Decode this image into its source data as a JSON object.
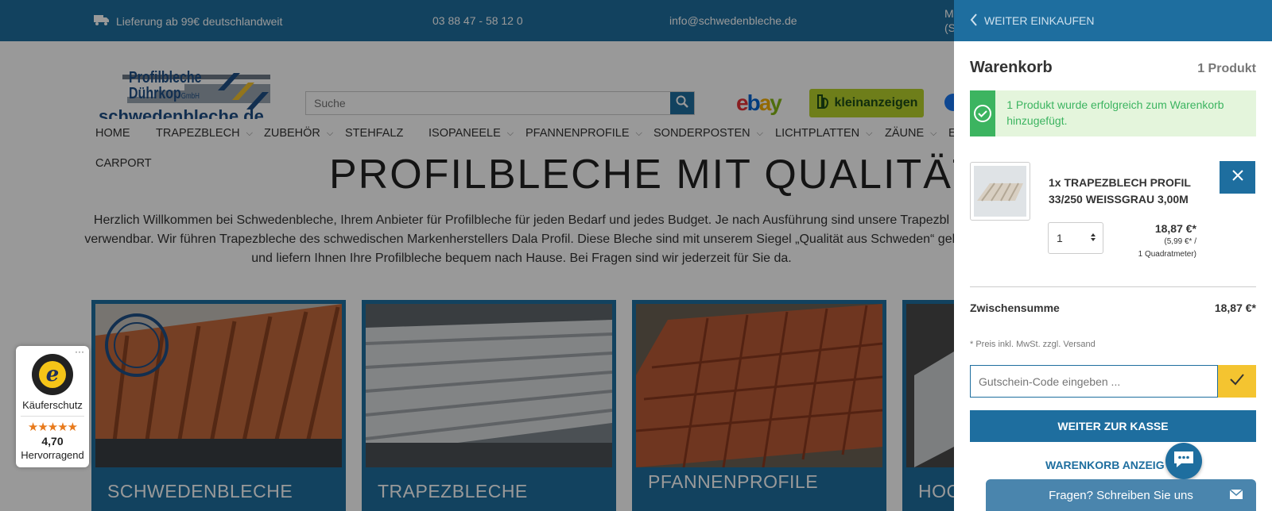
{
  "topbar": {
    "shipping": "Lieferung ab 99€ deutschlandweit",
    "phone": "03 88 47 - 58 12 0",
    "email": "info@schwedenbleche.de",
    "more_line1": "M",
    "more_line2": "(S"
  },
  "header": {
    "logo_line1": "Profilbleche",
    "logo_line2": "Dührkop",
    "logo_suffix": "GmbH",
    "logo_url": "schwedenbleche.de",
    "search_placeholder": "Suche",
    "ebay_label": "ebay",
    "kleinanzeigen_label": "kleinanzeigen"
  },
  "nav": {
    "items": [
      {
        "label": "HOME",
        "chevron": false
      },
      {
        "label": "TRAPEZBLECH",
        "chevron": true
      },
      {
        "label": "ZUBEHÖR",
        "chevron": true
      },
      {
        "label": "STEHFALZ",
        "chevron": false
      },
      {
        "label": "ISOPANEELE",
        "chevron": true
      },
      {
        "label": "PFANNENPROFILE",
        "chevron": true
      },
      {
        "label": "SONDERPOSTEN",
        "chevron": true
      },
      {
        "label": "LICHTPLATTEN",
        "chevron": true
      },
      {
        "label": "ZÄUNE",
        "chevron": true
      },
      {
        "label": "E",
        "chevron": false
      },
      {
        "label": "CARPORT",
        "chevron": false
      }
    ]
  },
  "hero": {
    "title": "PROFILBLECHE MIT QUALITÄT",
    "intro": "Herzlich Willkommen bei Schwedenbleche, Ihrem Anbieter für Profilbleche für jeden Bedarf und jedes Budget. Je nach Ausführung sind unsere Trapezbl verwendbar. Wir führen Trapezbleche des schwedischen Markenherstellers Dala Profil. Diese Bleche sind mit unserem Siegel „Qualität aus Schweden“ gek und liefern Ihnen Ihre Profilbleche bequem nach Hause. Bei Fragen sind wir jederzeit für Sie da."
  },
  "categories": [
    {
      "label": "SCHWEDENBLECHE"
    },
    {
      "label": "TRAPEZBLECHE"
    },
    {
      "label": "PFANNENPROFILE"
    },
    {
      "label": "HOC"
    }
  ],
  "trusted": {
    "label": "Käuferschutz",
    "stars": "★★★★★",
    "rating": "4,70",
    "verdict": "Hervorragend",
    "menu": "···"
  },
  "cart": {
    "back_label": "WEITER EINKAUFEN",
    "title": "Warenkorb",
    "count": "1 Produkt",
    "success_message": "1 Produkt wurde erfolgreich zum Warenkorb hinzugefügt.",
    "item": {
      "name": "1x TRAPEZBLECH PROFIL 33/250 WEISSGRAU 3,00M",
      "quantity": "1",
      "price": "18,87 €*",
      "unit_price": "(5,99 €* /",
      "unit_ref": "1 Quadratmeter)"
    },
    "subtotal_label": "Zwischensumme",
    "subtotal_value": "18,87 €*",
    "tax_note": "* Preis inkl. MwSt. zzgl. Versand",
    "voucher_placeholder": "Gutschein-Code eingeben ...",
    "checkout_label": "WEITER ZUR KASSE",
    "show_cart_label": "WARENKORB ANZEIG"
  },
  "chat": {
    "label": "Fragen? Schreiben Sie uns"
  },
  "colors": {
    "primary": "#1e6e9f",
    "success": "#3cb460",
    "accent": "#f4c430",
    "stars": "#e87a1c"
  }
}
